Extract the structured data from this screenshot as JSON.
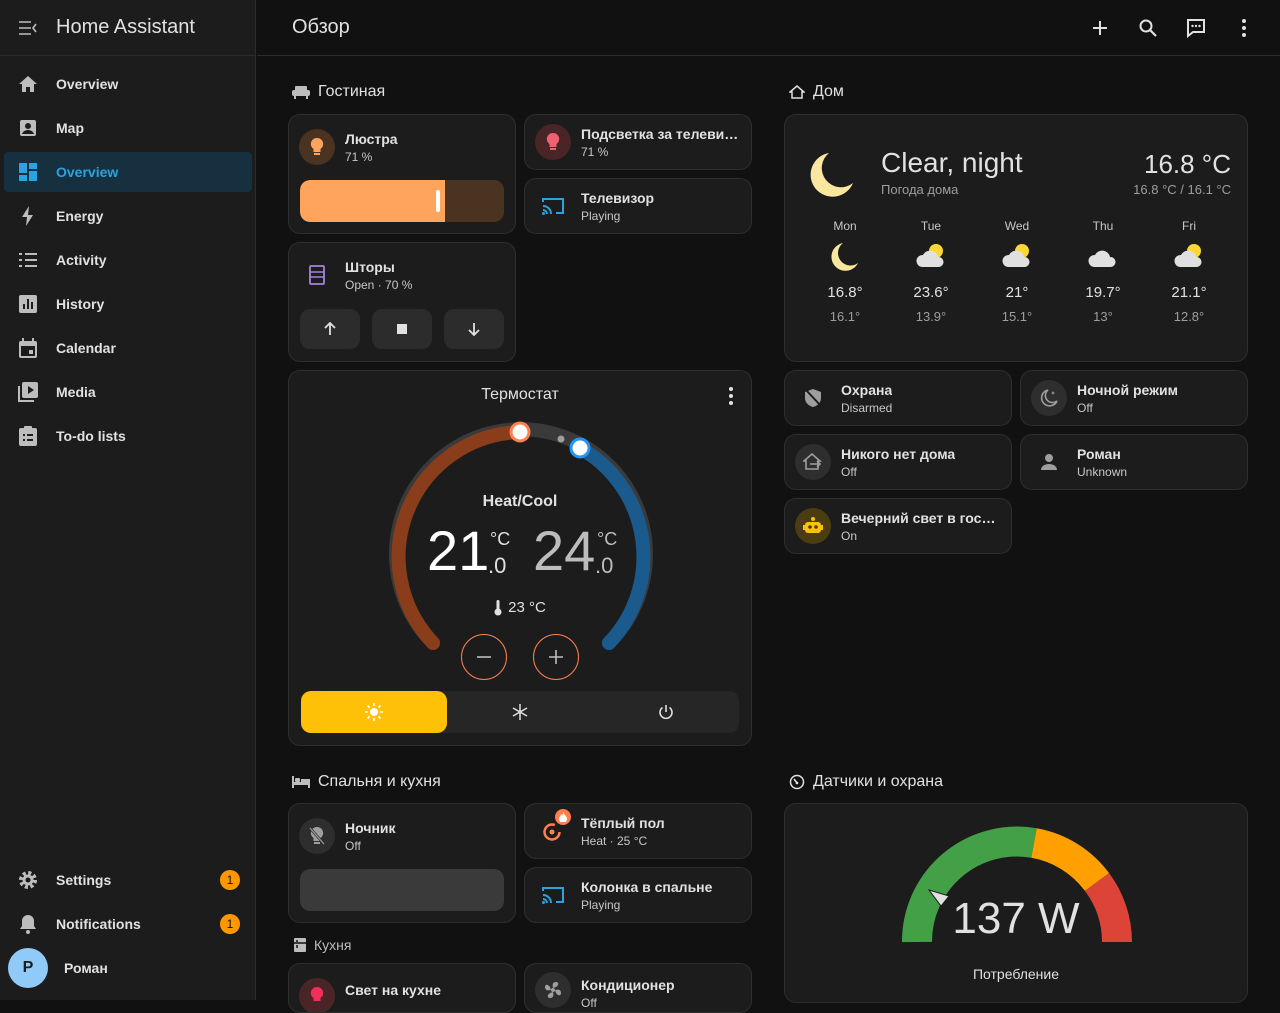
{
  "app_title": "Home Assistant",
  "page_title": "Обзор",
  "nav": {
    "overview1": "Overview",
    "map": "Map",
    "overview2": "Overview",
    "energy": "Energy",
    "activity": "Activity",
    "history": "History",
    "calendar": "Calendar",
    "media": "Media",
    "todo": "To-do lists",
    "settings": "Settings",
    "notifications": "Notifications",
    "settings_badge": "1",
    "notifications_badge": "1",
    "user_initial": "Р",
    "user_name": "Роман"
  },
  "living": {
    "title": "Гостиная",
    "chandelier": {
      "name": "Люстра",
      "state": "71 %",
      "brightness": 0.71
    },
    "tv_light": {
      "name": "Подсветка за телевизором",
      "state": "71 %"
    },
    "tv": {
      "name": "Телевизор",
      "state": "Playing"
    },
    "blinds": {
      "name": "Шторы",
      "state": "Open · 70 %"
    },
    "thermostat": {
      "title": "Термостат",
      "mode_label": "Heat/Cool",
      "low_int": "21",
      "low_dec": ".0",
      "low_unit": "°C",
      "high_int": "24",
      "high_dec": ".0",
      "high_unit": "°C",
      "current": "23 °C"
    }
  },
  "home": {
    "title": "Дом",
    "weather": {
      "condition": "Clear, night",
      "subtitle": "Погода дома",
      "temp": "16.8 °C",
      "range": "16.8 °C / 16.1 °C",
      "forecast": [
        {
          "day": "Mon",
          "hi": "16.8°",
          "lo": "16.1°",
          "icon": "moon-icon"
        },
        {
          "day": "Tue",
          "hi": "23.6°",
          "lo": "13.9°",
          "icon": "partly-cloudy-icon"
        },
        {
          "day": "Wed",
          "hi": "21°",
          "lo": "15.1°",
          "icon": "partly-cloudy-icon"
        },
        {
          "day": "Thu",
          "hi": "19.7°",
          "lo": "13°",
          "icon": "cloudy-icon"
        },
        {
          "day": "Fri",
          "hi": "21.1°",
          "lo": "12.8°",
          "icon": "partly-cloudy-icon"
        }
      ]
    },
    "alarm": {
      "name": "Охрана",
      "state": "Disarmed"
    },
    "night_mode": {
      "name": "Ночной режим",
      "state": "Off"
    },
    "away": {
      "name": "Никого нет дома",
      "state": "Off"
    },
    "person": {
      "name": "Роман",
      "state": "Unknown"
    },
    "evening_light": {
      "name": "Вечерний свет в гостиной",
      "state": "On"
    }
  },
  "bedroom": {
    "title": "Спальня и кухня",
    "nightlight": {
      "name": "Ночник",
      "state": "Off"
    },
    "floor": {
      "name": "Тёплый пол",
      "state": "Heat · 25 °C"
    },
    "speaker": {
      "name": "Колонка в спальне",
      "state": "Playing"
    },
    "kitchen_title": "Кухня",
    "kitchen_light": {
      "name": "Свет на кухне"
    },
    "ac": {
      "name": "Кондиционер",
      "state": "Off"
    }
  },
  "sensors": {
    "title": "Датчики и охрана",
    "power_value": "137 W",
    "power_label": "Потребление"
  },
  "colors": {
    "accent": "#2aa3e0",
    "light_on": "#ffa45c",
    "heat": "#ff7f50",
    "cool": "#2196f3",
    "heat_mode": "#ffc107"
  }
}
